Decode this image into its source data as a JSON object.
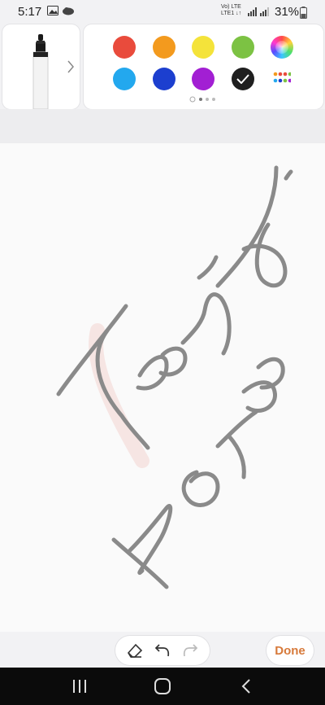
{
  "status_bar": {
    "time": "5:17",
    "network_line1": "Vo) LTE",
    "network_line2": "LTE1 ↓↑",
    "battery_percent": "31%"
  },
  "pen_panel": {
    "pen_icon": "marker-pen-icon",
    "expand_icon": "chevron-right-icon"
  },
  "colors": {
    "row1": [
      "#e94b3c",
      "#f39a1e",
      "#f4e33a",
      "#7cc243",
      "rainbow"
    ],
    "row2": [
      "#23a8ee",
      "#1c3fcf",
      "#a21fd3",
      "#1f1f1f",
      "palette"
    ],
    "selected": "#1f1f1f",
    "page_indicator": [
      "circle",
      "dot",
      "dot",
      "dot"
    ]
  },
  "canvas": {
    "handwriting_color": "#8a8a8a",
    "handwriting_text": "Trying Notes"
  },
  "bottom_toolbar": {
    "eraser_icon": "eraser-icon",
    "undo_icon": "undo-icon",
    "redo_icon": "redo-icon",
    "done_label": "Done",
    "done_color": "#d77a3b"
  },
  "nav_bar": {
    "recents_icon": "recents-icon",
    "home_icon": "home-icon",
    "back_icon": "back-icon"
  }
}
